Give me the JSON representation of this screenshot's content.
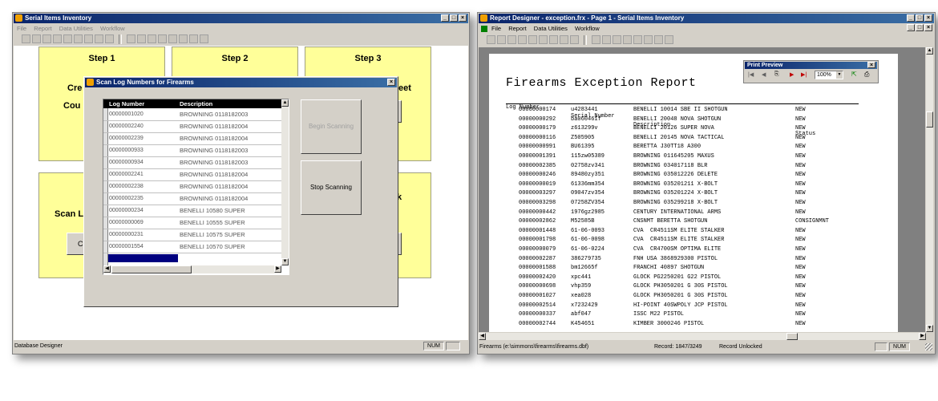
{
  "left_window": {
    "title": "Serial Items Inventory",
    "menu": [
      "File",
      "Report",
      "Data Utilities",
      "Workflow"
    ],
    "status_left": "Database Designer",
    "status_num": "NUM",
    "steps": {
      "step1": "Step 1",
      "step2": "Step 2",
      "step3": "Step 3",
      "frag_cre": "Cre",
      "frag_cou": "Cou",
      "frag_eet": "eet",
      "frag_scanl": "Scan L",
      "frag_k": "k",
      "frag_c": "C"
    },
    "dialog": {
      "title": "Scan Log Numbers for Firearms",
      "col_log": "Log Number",
      "col_desc": "Description",
      "begin_label": "Begin Scanning",
      "stop_label": "Stop Scanning",
      "rows": [
        {
          "log": "00000001020",
          "desc": "BROWNING 0118182003"
        },
        {
          "log": "00000002240",
          "desc": "BROWNING 0118182004"
        },
        {
          "log": "00000002239",
          "desc": "BROWNING 0118182004"
        },
        {
          "log": "00000000933",
          "desc": "BROWNING 0118182003"
        },
        {
          "log": "00000000934",
          "desc": "BROWNING 0118182003"
        },
        {
          "log": "00000002241",
          "desc": "BROWNING 0118182004"
        },
        {
          "log": "00000002238",
          "desc": "BROWNING 0118182004"
        },
        {
          "log": "00000002235",
          "desc": "BROWNING 0118182004"
        },
        {
          "log": "00000000234",
          "desc": "BENELLI 10580 SUPER"
        },
        {
          "log": "00000000069",
          "desc": "BENELLI 10555 SUPER"
        },
        {
          "log": "00000000231",
          "desc": "BENELLI 10575 SUPER"
        },
        {
          "log": "00000001554",
          "desc": "BENELLI 10570 SUPER"
        }
      ]
    }
  },
  "right_window": {
    "title": "Report Designer - exception.frx - Page 1 - Serial Items Inventory",
    "menu": [
      "File",
      "Report",
      "Data Utilities",
      "Workflow"
    ],
    "preview": {
      "title": "Print Preview",
      "zoom": "100%"
    },
    "report": {
      "title": "Firearms Exception Report",
      "headers": {
        "log": "Log Number",
        "serial": "Serial Number",
        "desc": "Description",
        "status": "Status"
      },
      "rows": [
        {
          "log": "00000000174",
          "serial": "u4283441",
          "desc": "BENELLI 10014 SBE II SHOTGUN",
          "status": "NEW"
        },
        {
          "log": "00000000292",
          "serial": "ba060461f",
          "desc": "BENELLI 20048 NOVA SHOTGUN",
          "status": "NEW"
        },
        {
          "log": "00000000179",
          "serial": "z613299v",
          "desc": "BENELLI 20126 SUPER NOVA",
          "status": "NEW"
        },
        {
          "log": "00000000116",
          "serial": "Z505905",
          "desc": "BENELLI 20145 NOVA TACTICAL",
          "status": "NEW"
        },
        {
          "log": "00000000991",
          "serial": "BU61395",
          "desc": "BERETTA J30TT18 A300",
          "status": "NEW"
        },
        {
          "log": "00000001391",
          "serial": "115zw05389",
          "desc": "BROWNING 011645205 MAXUS",
          "status": "NEW"
        },
        {
          "log": "00000002385",
          "serial": "02758zv341",
          "desc": "BROWNING 034017118 BLR",
          "status": "NEW"
        },
        {
          "log": "00000000246",
          "serial": "89480zy351",
          "desc": "BROWNING 035012226 DELETE",
          "status": "NEW"
        },
        {
          "log": "00000000019",
          "serial": "61336mm354",
          "desc": "BROWNING 035201211 X-BOLT",
          "status": "NEW"
        },
        {
          "log": "00000003297",
          "serial": "09047zv354",
          "desc": "BROWNING 035201224 X-BOLT",
          "status": "NEW"
        },
        {
          "log": "00000003298",
          "serial": "07258ZV354",
          "desc": "BROWNING 035299218 X-BOLT",
          "status": "NEW"
        },
        {
          "log": "00000000442",
          "serial": "1976gz2985",
          "desc": "CENTURY INTERNATIONAL ARMS",
          "status": "NEW"
        },
        {
          "log": "00000002862",
          "serial": "M52585B",
          "desc": "CNSNMT BERETTA SHOTGUN",
          "status": "CONSIGNMNT"
        },
        {
          "log": "00000001448",
          "serial": "61-06-0093",
          "desc": "CVA  CR4511SM ELITE STALKER",
          "status": "NEW"
        },
        {
          "log": "00000001798",
          "serial": "61-06-0098",
          "desc": "CVA  CR4511SM ELITE STALKER",
          "status": "NEW"
        },
        {
          "log": "00000000079",
          "serial": "61-06-0224",
          "desc": "CVA  CR4700SM OPTIMA ELITE",
          "status": "NEW"
        },
        {
          "log": "00000002287",
          "serial": "386279735",
          "desc": "FNH USA 3868929300 PISTOL",
          "status": "NEW"
        },
        {
          "log": "00000001588",
          "serial": "bm12665f",
          "desc": "FRANCHI 40897 SHOTGUN",
          "status": "NEW"
        },
        {
          "log": "00000002420",
          "serial": "xpc441",
          "desc": "GLOCK PG2250201 G22 PISTOL",
          "status": "NEW"
        },
        {
          "log": "00000000698",
          "serial": "vhp359",
          "desc": "GLOCK PH3050201 G 30S PISTOL",
          "status": "NEW"
        },
        {
          "log": "00000001027",
          "serial": "xea028",
          "desc": "GLOCK PH3050201 G 30S PISTOL",
          "status": "NEW"
        },
        {
          "log": "00000002514",
          "serial": "x7232429",
          "desc": "HI-POINT 40SWPOLY JCP PISTOL",
          "status": "NEW"
        },
        {
          "log": "00000000337",
          "serial": "abf047",
          "desc": "ISSC M22 PISTOL",
          "status": "NEW"
        },
        {
          "log": "00000002744",
          "serial": "K454651",
          "desc": "KIMBER 3000246 PISTOL",
          "status": "NEW"
        }
      ]
    },
    "status_left": "Firearms (e:\\simmons\\firearms\\firearms.dbf)",
    "status_record": "Record: 1847/3249",
    "status_lock": "Record Unlocked",
    "status_num": "NUM"
  }
}
